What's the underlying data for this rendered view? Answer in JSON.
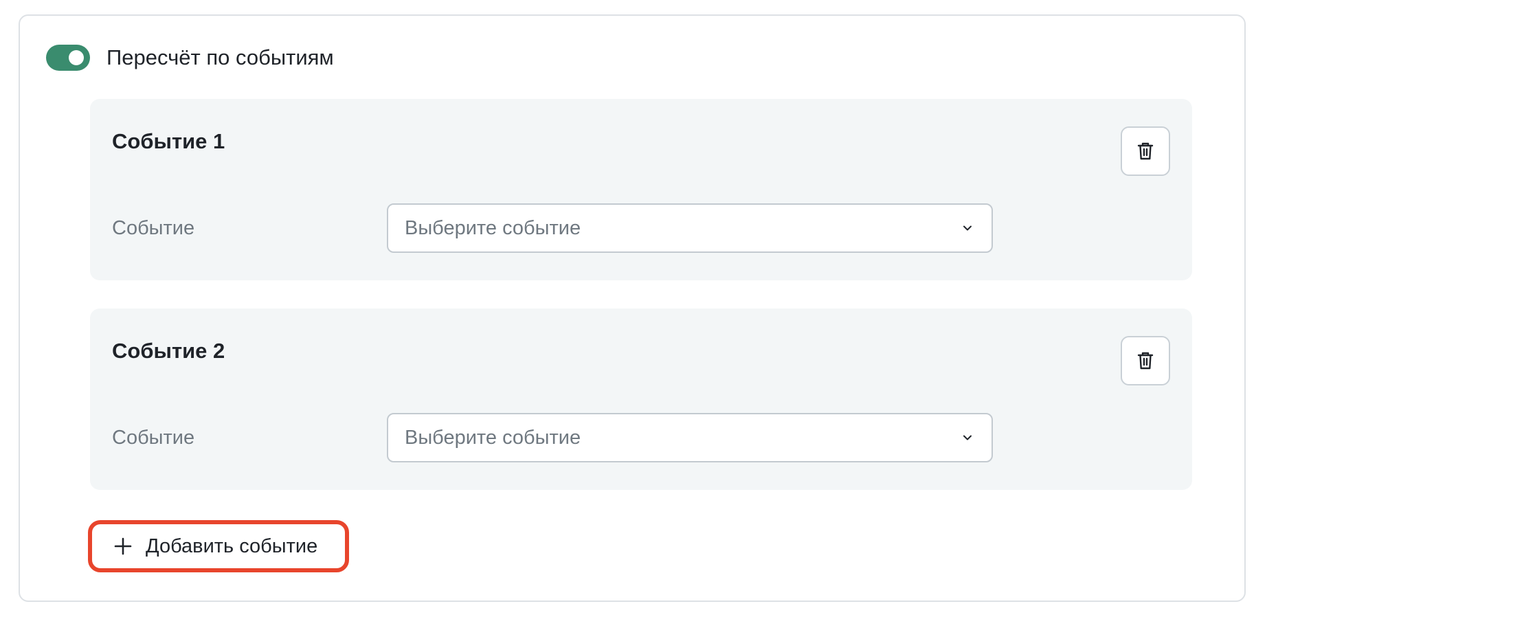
{
  "toggle": {
    "label": "Пересчёт по событиям",
    "enabled": true,
    "color": "#3a8c6e"
  },
  "events": [
    {
      "title": "Событие 1",
      "field_label": "Событие",
      "select_placeholder": "Выберите событие",
      "delete_icon": "trash-icon"
    },
    {
      "title": "Событие 2",
      "field_label": "Событие",
      "select_placeholder": "Выберите событие",
      "delete_icon": "trash-icon"
    }
  ],
  "add_button": {
    "label": "Добавить событие",
    "icon": "plus-icon",
    "highlight_color": "#e8452c"
  }
}
